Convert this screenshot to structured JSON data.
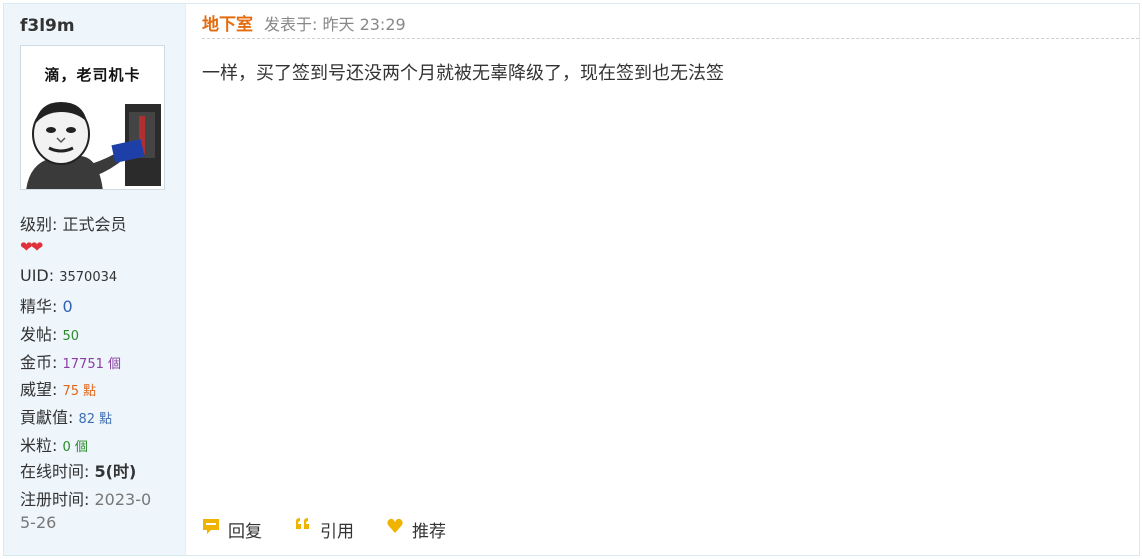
{
  "user": {
    "name": "f3l9m",
    "avatar_caption": "滴，老司机卡",
    "level_label": "级别:",
    "level_value": "正式会员",
    "hearts": "❤❤",
    "uid_label": "UID:",
    "uid_value": "3570034",
    "digest_label": "精华:",
    "digest_value": "0",
    "posts_label": "发帖:",
    "posts_value": "50",
    "coins_label": "金币:",
    "coins_value": "17751 個",
    "prestige_label": "威望:",
    "prestige_value": "75 點",
    "contrib_label": "貢獻值:",
    "contrib_value": "82 點",
    "rice_label": "米粒:",
    "rice_value": "0 個",
    "online_label": "在线时间:",
    "online_value": "5(时)",
    "reg_label": "注册时间:",
    "reg_value_a": "2023-0",
    "reg_value_b": "5-26"
  },
  "post": {
    "author": "地下室",
    "posted": "发表于: 昨天 23:29",
    "content": "一样，买了签到号还没两个月就被无辜降级了，现在签到也无法签"
  },
  "actions": {
    "reply": "回复",
    "quote": "引用",
    "recommend": "推荐"
  },
  "colors": {
    "accent_author": "#e46c10",
    "sidebar_bg": "#eef5fb",
    "icon_gold": "#f0b400"
  }
}
